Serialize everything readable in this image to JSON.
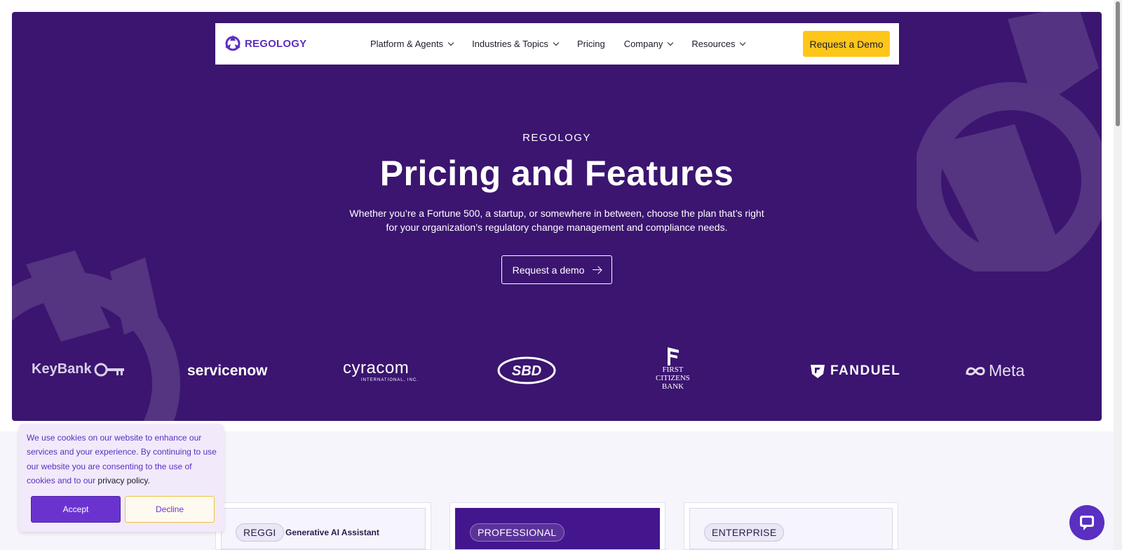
{
  "nav": {
    "logo_text": "REGOLOGY",
    "items": [
      {
        "label": "Platform & Agents",
        "dropdown": true
      },
      {
        "label": "Industries & Topics",
        "dropdown": true
      },
      {
        "label": "Pricing",
        "dropdown": false
      },
      {
        "label": "Company",
        "dropdown": true
      },
      {
        "label": "Resources",
        "dropdown": true
      }
    ],
    "cta_label": "Request a Demo"
  },
  "hero": {
    "eyebrow": "REGOLOGY",
    "title": "Pricing and Features",
    "subtitle_line1": "Whether you’re a Fortune 500, a startup, or somewhere in between, choose the plan that’s right",
    "subtitle_line2": "for your organization’s regulatory change management and compliance needs.",
    "cta_label": "Request a demo",
    "background_color": "#3b1570"
  },
  "client_logos": [
    "KeyBank",
    "servicenow",
    "cyracom",
    "SBD",
    "First Citizens Bank",
    "FANDUEL",
    "Meta"
  ],
  "client_logo_subtext": {
    "cyracom": "INTERNATIONAL, INC.",
    "first_citizens": [
      "FIRST",
      "CITIZENS",
      "BANK"
    ]
  },
  "plans": [
    {
      "tag": "REGGI",
      "note": "Generative AI Assistant"
    },
    {
      "tag": "PROFESSIONAL",
      "note": ""
    },
    {
      "tag": "ENTERPRISE",
      "note": ""
    }
  ],
  "cookie_banner": {
    "text": "We use cookies on our website to enhance our services and your experience. By continuing to use our website you are consenting to the use of cookies and to our",
    "link_text": "privacy policy.",
    "accept_label": "Accept",
    "decline_label": "Decline"
  },
  "colors": {
    "brand_purple": "#5a2fc2",
    "accent_yellow": "#ffc61a",
    "pro_card": "#44168d"
  },
  "icons": [
    "regology-logo-icon",
    "chevron-down-icon",
    "arrow-right-icon",
    "chat-icon"
  ]
}
